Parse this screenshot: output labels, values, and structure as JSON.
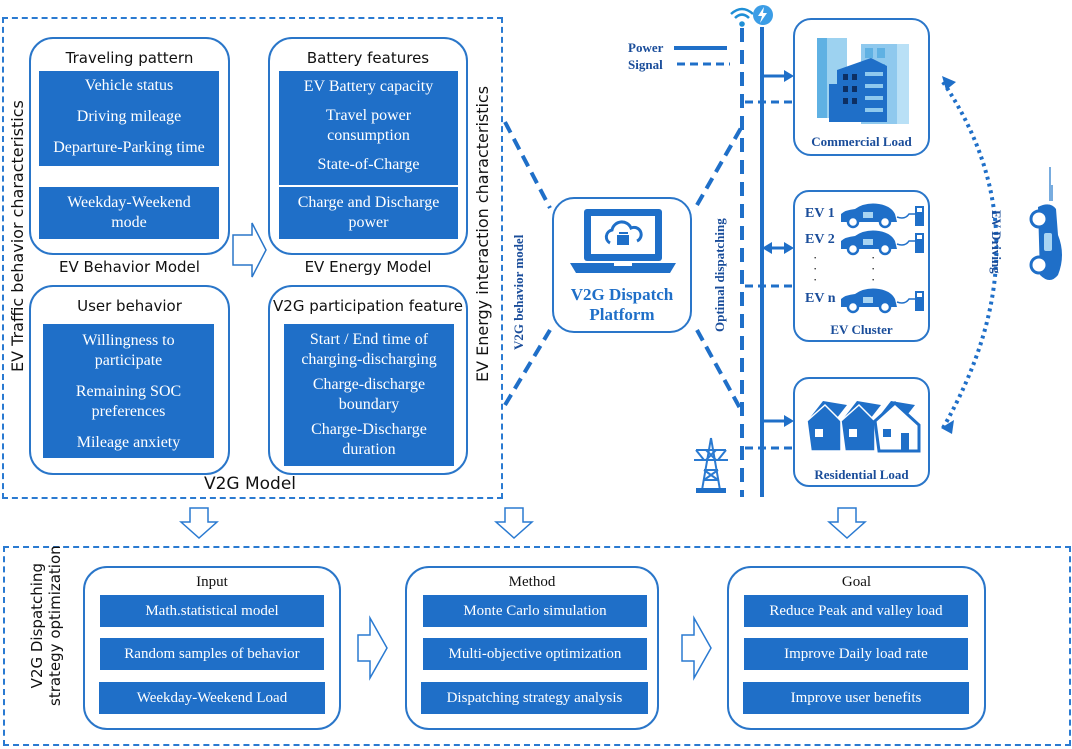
{
  "v2g_model": {
    "title": "V2G Model",
    "left_side_label": "EV Traffic behavior characteristics",
    "right_side_label": "EV Energy interaction characteristics",
    "traveling_pattern": {
      "title": "Traveling pattern",
      "items": [
        "Vehicle status",
        "Driving mileage",
        "Departure-Parking time"
      ],
      "mode_lines": [
        "Weekday-Weekend",
        "mode"
      ]
    },
    "behavior_model_caption": "EV Behavior Model",
    "battery_features": {
      "title": "Battery features",
      "items": [
        "EV Battery capacity",
        "Travel power",
        "consumption",
        "State-of-Charge"
      ],
      "power_lines": [
        "Charge and Discharge",
        "power"
      ]
    },
    "energy_model_caption": "EV Energy Model",
    "user_behavior": {
      "title": "User behavior",
      "lines": [
        "Willingness to",
        "participate",
        "Remaining SOC",
        "preferences",
        "Mileage anxiety"
      ]
    },
    "v2g_participation": {
      "title": "V2G participation feature",
      "lines": [
        "Start / End time of",
        "charging-discharging",
        "Charge-discharge",
        "boundary",
        "Charge-Discharge",
        "duration"
      ]
    }
  },
  "platform": {
    "behavior_link_label": "V2G behavior model",
    "dispatch_link_label": "Optimal dispatching",
    "title_lines": [
      "V2G Dispatch",
      "Platform"
    ],
    "icon": "laptop-cloud-icon"
  },
  "grid": {
    "legend": {
      "power": "Power",
      "signal": "Signal"
    },
    "icons": {
      "wifi": "wifi-icon",
      "lightning": "lightning-icon",
      "tower": "transmission-tower-icon"
    },
    "commercial_load": "Commercial Load",
    "ev_cluster": {
      "title": "EV Cluster",
      "ev_labels": [
        "EV 1",
        "EV 2",
        "EV n"
      ]
    },
    "residential_load": "Residential Load",
    "ev_driving": "EV Driving"
  },
  "optimization": {
    "side_label_lines": [
      "V2G Dispatching",
      "strategy optimization"
    ],
    "input": {
      "title": "Input",
      "items": [
        "Math.statistical model",
        "Random samples of behavior",
        "Weekday-Weekend Load"
      ]
    },
    "method": {
      "title": "Method",
      "items": [
        "Monte Carlo simulation",
        "Multi-objective optimization",
        "Dispatching strategy analysis"
      ]
    },
    "goal": {
      "title": "Goal",
      "items": [
        "Reduce Peak and valley load",
        "Improve Daily load rate",
        "Improve user benefits"
      ]
    }
  },
  "colors": {
    "primary_blue": "#1f6fc8",
    "border_blue": "#2a76c9",
    "label_navy": "#1a4d9a",
    "light_blue": "#8fc9ee"
  }
}
